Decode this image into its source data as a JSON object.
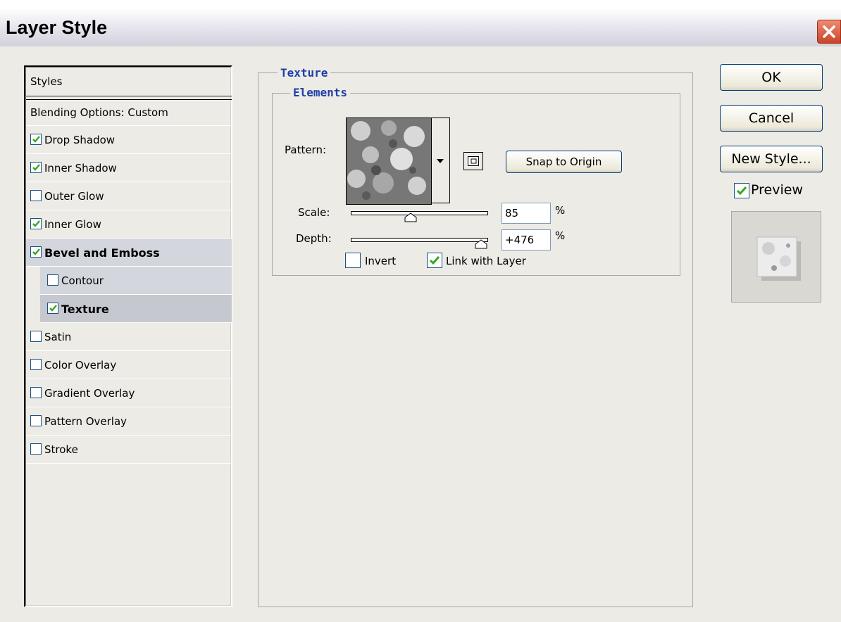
{
  "window": {
    "title": "Layer Style"
  },
  "styles_list": {
    "header": "Styles",
    "blending": "Blending Options: Custom",
    "items": [
      {
        "label": "Drop Shadow",
        "checked": true
      },
      {
        "label": "Inner Shadow",
        "checked": true
      },
      {
        "label": "Outer Glow",
        "checked": false
      },
      {
        "label": "Inner Glow",
        "checked": true
      },
      {
        "label": "Bevel and Emboss",
        "checked": true
      },
      {
        "label": "Contour",
        "checked": false
      },
      {
        "label": "Texture",
        "checked": true
      },
      {
        "label": "Satin",
        "checked": false
      },
      {
        "label": "Color Overlay",
        "checked": false
      },
      {
        "label": "Gradient Overlay",
        "checked": false
      },
      {
        "label": "Pattern Overlay",
        "checked": false
      },
      {
        "label": "Stroke",
        "checked": false
      }
    ]
  },
  "texture_panel": {
    "title": "Texture",
    "group_title": "Elements",
    "pattern_label": "Pattern:",
    "snap_button": "Snap to Origin",
    "scale_label": "Scale:",
    "scale_value": "85",
    "scale_unit": "%",
    "depth_label": "Depth:",
    "depth_value": "+476",
    "depth_unit": "%",
    "invert_label": "Invert",
    "invert_checked": false,
    "link_label": "Link with Layer",
    "link_checked": true
  },
  "buttons": {
    "ok": "OK",
    "cancel": "Cancel",
    "new_style": "New Style..."
  },
  "preview": {
    "label": "Preview",
    "checked": true
  },
  "icons": {
    "close": "close-icon",
    "check": "check-icon",
    "dropdown": "dropdown-arrow-icon",
    "new_pattern": "new-preset-icon"
  },
  "colors": {
    "accent": "#1f3fa6",
    "check": "#2eaa1f",
    "close": "#cc4425"
  }
}
